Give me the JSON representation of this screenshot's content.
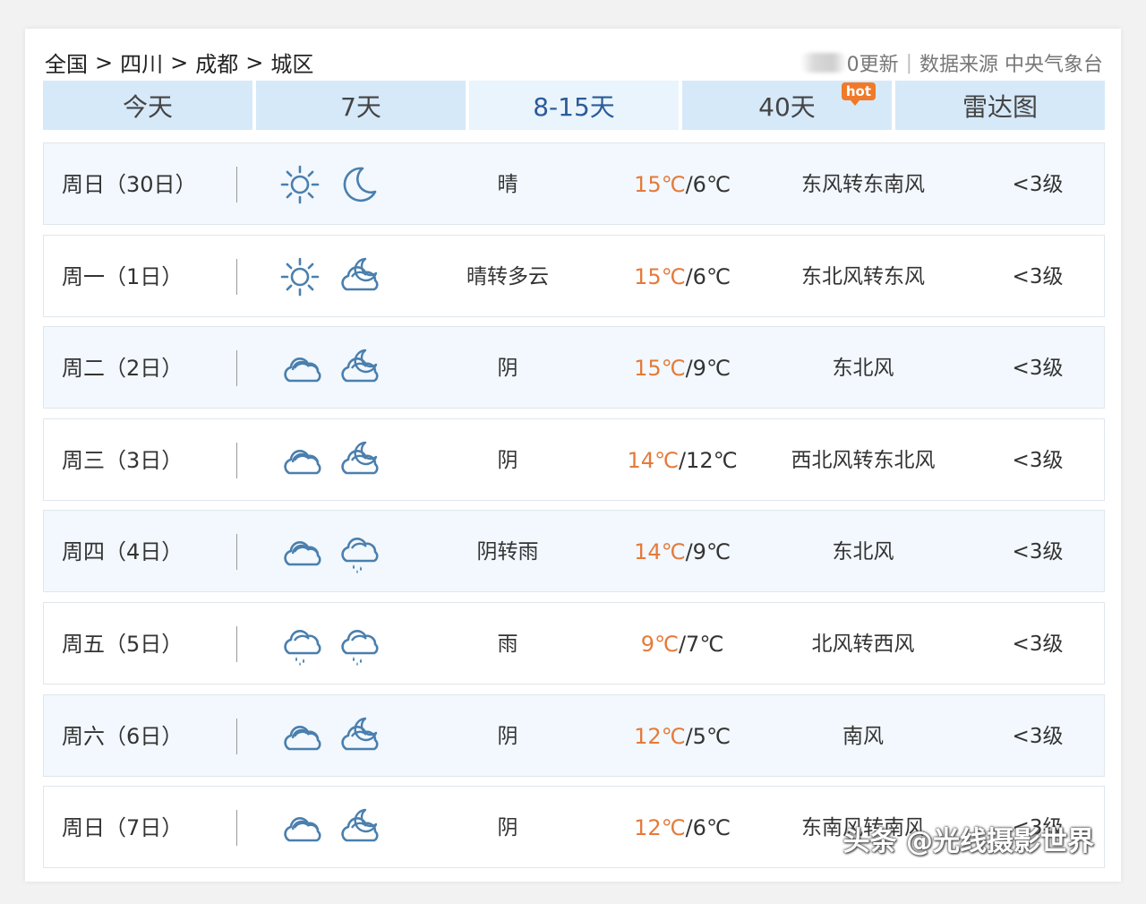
{
  "breadcrumb": {
    "items": [
      "全国",
      "四川",
      "成都",
      "城区"
    ],
    "separator": ">"
  },
  "source": {
    "update_suffix": "0更新",
    "data_source": "数据来源 中央气象台"
  },
  "tabs": [
    {
      "label": "今天",
      "active": false
    },
    {
      "label": "7天",
      "active": false
    },
    {
      "label": "8-15天",
      "active": true
    },
    {
      "label": "40天",
      "active": false,
      "badge": "hot"
    },
    {
      "label": "雷达图",
      "active": false
    }
  ],
  "forecast": [
    {
      "date": "周日（30日）",
      "day_icon": "sun-icon",
      "night_icon": "moon-icon",
      "desc": "晴",
      "high": "15℃",
      "low": "6℃",
      "wind": "东风转东南风",
      "level": "<3级"
    },
    {
      "date": "周一（1日）",
      "day_icon": "sun-icon",
      "night_icon": "cloud-moon-icon",
      "desc": "晴转多云",
      "high": "15℃",
      "low": "6℃",
      "wind": "东北风转东风",
      "level": "<3级"
    },
    {
      "date": "周二（2日）",
      "day_icon": "overcast-icon",
      "night_icon": "cloud-moon-icon",
      "desc": "阴",
      "high": "15℃",
      "low": "9℃",
      "wind": "东北风",
      "level": "<3级"
    },
    {
      "date": "周三（3日）",
      "day_icon": "overcast-icon",
      "night_icon": "cloud-moon-icon",
      "desc": "阴",
      "high": "14℃",
      "low": "12℃",
      "wind": "西北风转东北风",
      "level": "<3级"
    },
    {
      "date": "周四（4日）",
      "day_icon": "overcast-icon",
      "night_icon": "rain-icon",
      "desc": "阴转雨",
      "high": "14℃",
      "low": "9℃",
      "wind": "东北风",
      "level": "<3级"
    },
    {
      "date": "周五（5日）",
      "day_icon": "rain-icon",
      "night_icon": "rain-icon",
      "desc": "雨",
      "high": "9℃",
      "low": "7℃",
      "wind": "北风转西风",
      "level": "<3级"
    },
    {
      "date": "周六（6日）",
      "day_icon": "overcast-icon",
      "night_icon": "cloud-moon-icon",
      "desc": "阴",
      "high": "12℃",
      "low": "5℃",
      "wind": "南风",
      "level": "<3级"
    },
    {
      "date": "周日（7日）",
      "day_icon": "overcast-icon",
      "night_icon": "cloud-moon-icon",
      "desc": "阴",
      "high": "12℃",
      "low": "6℃",
      "wind": "东南风转南风",
      "level": "<3级"
    }
  ],
  "watermark": "头条 @光线摄影世界",
  "colors": {
    "tab_bg": "#d6e9f8",
    "tab_active_bg": "#eaf4fc",
    "tab_active_text": "#2a5b9a",
    "high_temp": "#e57a3a",
    "hot_badge": "#f07a2a",
    "icon_stroke": "#4a7fae"
  }
}
